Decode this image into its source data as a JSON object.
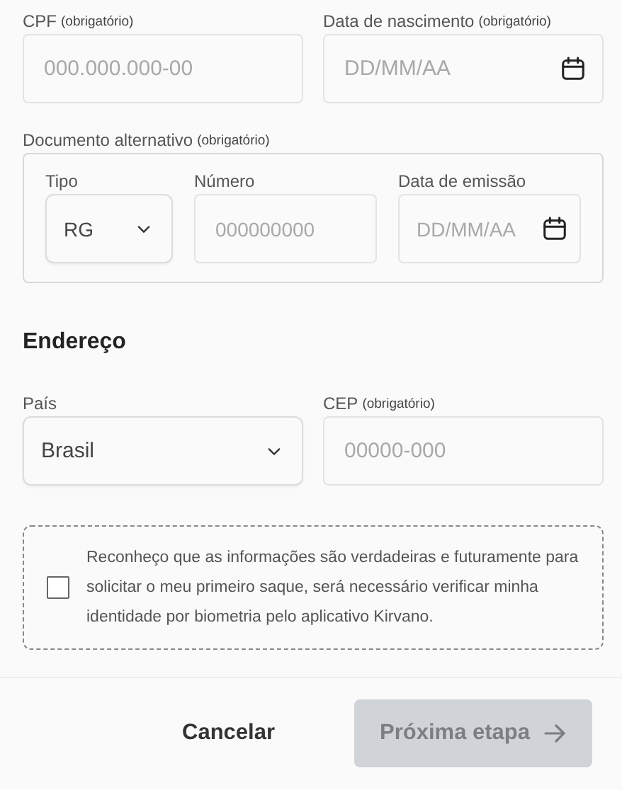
{
  "personal_fields": [
    {
      "kind": "text",
      "label": "CPF",
      "note": "(obrigatório)",
      "placeholder": "000.000.000-00"
    },
    {
      "kind": "date",
      "label": "Data de nascimento",
      "note": "(obrigatório)",
      "placeholder": "DD/MM/AA"
    }
  ],
  "alt_document": {
    "label": "Documento alternativo",
    "note": "(obrigatório)",
    "fields": [
      {
        "kind": "select",
        "label": "Tipo",
        "value": "RG"
      },
      {
        "kind": "text",
        "label": "Número",
        "placeholder": "000000000"
      },
      {
        "kind": "date",
        "label": "Data de emissão",
        "placeholder": "DD/MM/AA"
      }
    ]
  },
  "address": {
    "heading": "Endereço",
    "fields": [
      {
        "kind": "select",
        "label": "País",
        "value": "Brasil"
      },
      {
        "kind": "text",
        "label": "CEP",
        "note": "(obrigatório)",
        "placeholder": "00000-000"
      }
    ]
  },
  "consent": {
    "checked": false,
    "text": "Reconheço que as informações são verdadeiras e futuramente para solicitar o meu primeiro saque, será necessário verificar minha identidade por biometria pelo aplicativo Kirvano."
  },
  "buttons": [
    {
      "kind": "secondary",
      "label": "Cancelar",
      "disabled": false
    },
    {
      "kind": "primary",
      "label": "Próxima etapa",
      "disabled": true
    }
  ]
}
